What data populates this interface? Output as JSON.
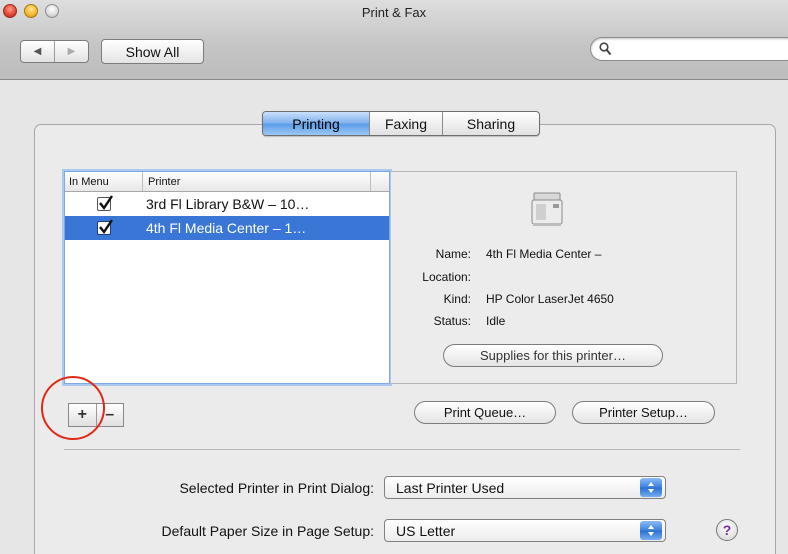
{
  "window": {
    "title": "Print & Fax"
  },
  "toolbar": {
    "show_all_label": "Show All",
    "search": {
      "placeholder": "",
      "value": ""
    }
  },
  "tabs": [
    {
      "label": "Printing",
      "active": true
    },
    {
      "label": "Faxing",
      "active": false
    },
    {
      "label": "Sharing",
      "active": false
    }
  ],
  "printer_list": {
    "columns": [
      "In Menu",
      "Printer"
    ],
    "rows": [
      {
        "in_menu": true,
        "name": "3rd Fl Library B&W – 10…",
        "selected": false
      },
      {
        "in_menu": true,
        "name": "4th Fl Media Center – 1…",
        "selected": true
      }
    ]
  },
  "details": {
    "name_label": "Name:",
    "name_value": "4th Fl Media Center –",
    "location_label": "Location:",
    "location_value": "",
    "kind_label": "Kind:",
    "kind_value": "HP Color LaserJet 4650",
    "status_label": "Status:",
    "status_value": "Idle",
    "supplies_button": "Supplies for this printer…"
  },
  "list_controls": {
    "add": "+",
    "remove": "–"
  },
  "buttons": {
    "print_queue": "Print Queue…",
    "printer_setup": "Printer Setup…"
  },
  "settings": {
    "selected_printer_label": "Selected Printer in Print Dialog:",
    "selected_printer_value": "Last Printer Used",
    "paper_size_label": "Default Paper Size in Page Setup:",
    "paper_size_value": "US Letter"
  },
  "help": {
    "label": "?"
  },
  "colors": {
    "selection": "#3a76d6",
    "annotation_ring": "#e02818",
    "tab_active": "#5a9be8"
  },
  "icons": [
    "search-icon",
    "back-arrow-icon",
    "forward-arrow-icon",
    "printer-icon",
    "checkmark-icon",
    "popup-arrows-icon",
    "help-icon"
  ]
}
